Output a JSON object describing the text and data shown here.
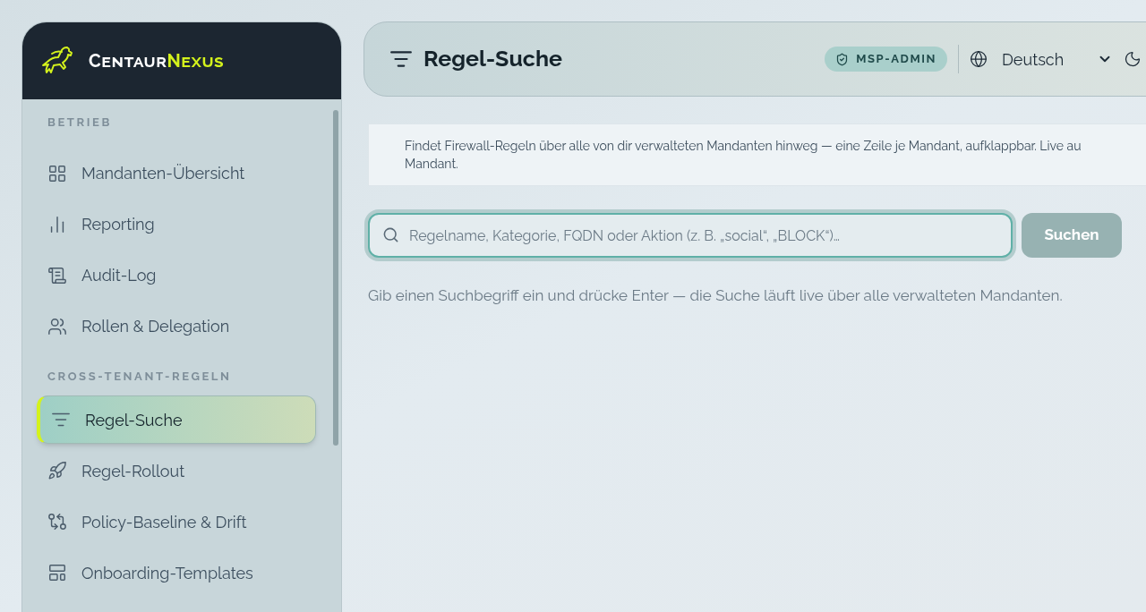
{
  "brand": {
    "part1": "Centaur",
    "part2": "Nexus"
  },
  "sidebar": {
    "sections": [
      {
        "title": "BETRIEB",
        "items": [
          {
            "label": "Mandanten-Übersicht",
            "selected": false
          },
          {
            "label": "Reporting",
            "selected": false
          },
          {
            "label": "Audit-Log",
            "selected": false
          },
          {
            "label": "Rollen & Delegation",
            "selected": false
          }
        ]
      },
      {
        "title": "CROSS-TENANT-REGELN",
        "items": [
          {
            "label": "Regel-Suche",
            "selected": true
          },
          {
            "label": "Regel-Rollout",
            "selected": false
          },
          {
            "label": "Policy-Baseline & Drift",
            "selected": false
          },
          {
            "label": "Onboarding-Templates",
            "selected": false
          }
        ]
      }
    ]
  },
  "header": {
    "title": "Regel-Suche",
    "role_badge": "MSP-ADMIN",
    "language": "Deutsch"
  },
  "notice": [
    "Findet Firewall-Regeln über alle von dir verwalteten Mandanten hinweg — eine Zeile je Mandant, aufklappbar. Live au",
    "Mandant."
  ],
  "search": {
    "placeholder": "Regelname, Kategorie, FQDN oder Aktion (z. B. „social“, „BLOCK“)…",
    "button": "Suchen"
  },
  "hint": "Gib einen Suchbegriff ein und drücke Enter — die Suche läuft live über alle verwalteten Mandanten."
}
